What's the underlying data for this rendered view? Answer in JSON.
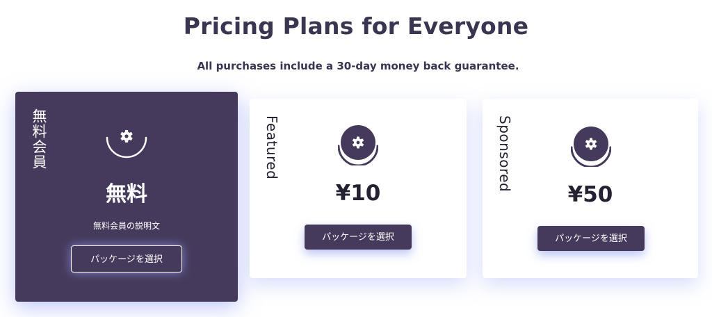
{
  "header": {
    "title": "Pricing Plans for Everyone",
    "subtitle": "All purchases include a 30-day money back guarantee."
  },
  "plans": [
    {
      "name": "無料会員",
      "icon": "gear-icon",
      "price": "無料",
      "description": "無料会員の説明文",
      "button_label": "パッケージを選択"
    },
    {
      "name": "Featured",
      "icon": "gear-icon",
      "price": "¥10",
      "button_label": "パッケージを選択"
    },
    {
      "name": "Sponsored",
      "icon": "gear-icon",
      "price": "¥50",
      "button_label": "パッケージを選択"
    }
  ],
  "colors": {
    "primary": "#463a5c",
    "heading": "#3a3550",
    "glow": "#8c9bf5",
    "white": "#ffffff"
  }
}
